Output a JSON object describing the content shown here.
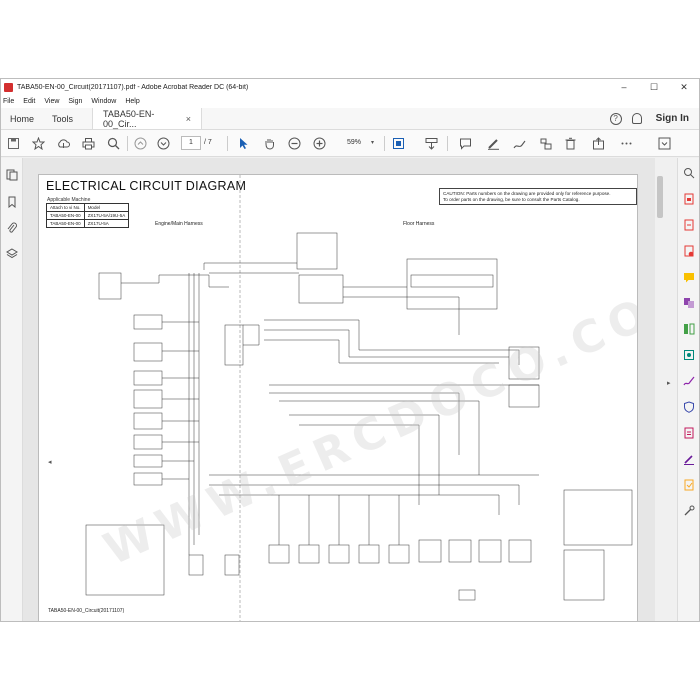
{
  "window": {
    "title": "TABA50-EN-00_Circuit(20171107).pdf - Adobe Acrobat Reader DC (64-bit)",
    "controls": [
      "–",
      "☐",
      "✕"
    ]
  },
  "menu": [
    "File",
    "Edit",
    "View",
    "Sign",
    "Window",
    "Help"
  ],
  "tabs": {
    "home": "Home",
    "tools": "Tools",
    "document": "TABA50-EN-00_Cir...",
    "close": "×",
    "help": "?",
    "sign_in": "Sign In"
  },
  "toolbar": {
    "page_current": "1",
    "page_total": "/ 7",
    "zoom": "59%",
    "zoom_arrow": "▾"
  },
  "document": {
    "title": "ELECTRICAL CIRCUIT DIAGRAM",
    "applicable_machine_label": "Applicable Machine",
    "table": {
      "headers": [
        "Attach to vi No.",
        "Model"
      ],
      "rows": [
        [
          "TABA50-EN-00",
          "ZX17U-5A/19U-5A"
        ],
        [
          "TABA50-EN-00",
          "ZX17U-5A"
        ]
      ]
    },
    "caution_line1": "CAUTION: Parts numbers on the drawing are provided only for reference purpose.",
    "caution_line2": "To order parts on the drawing, be sure to consult the Parts Catalog.",
    "engine_harness_label": "Engine/Main Harness",
    "floor_harness_label": "Floor Harness",
    "footer": "TABA50-EN-00_Circuit(20171107)",
    "watermark": "WWW.ERCDOCO.COM"
  }
}
